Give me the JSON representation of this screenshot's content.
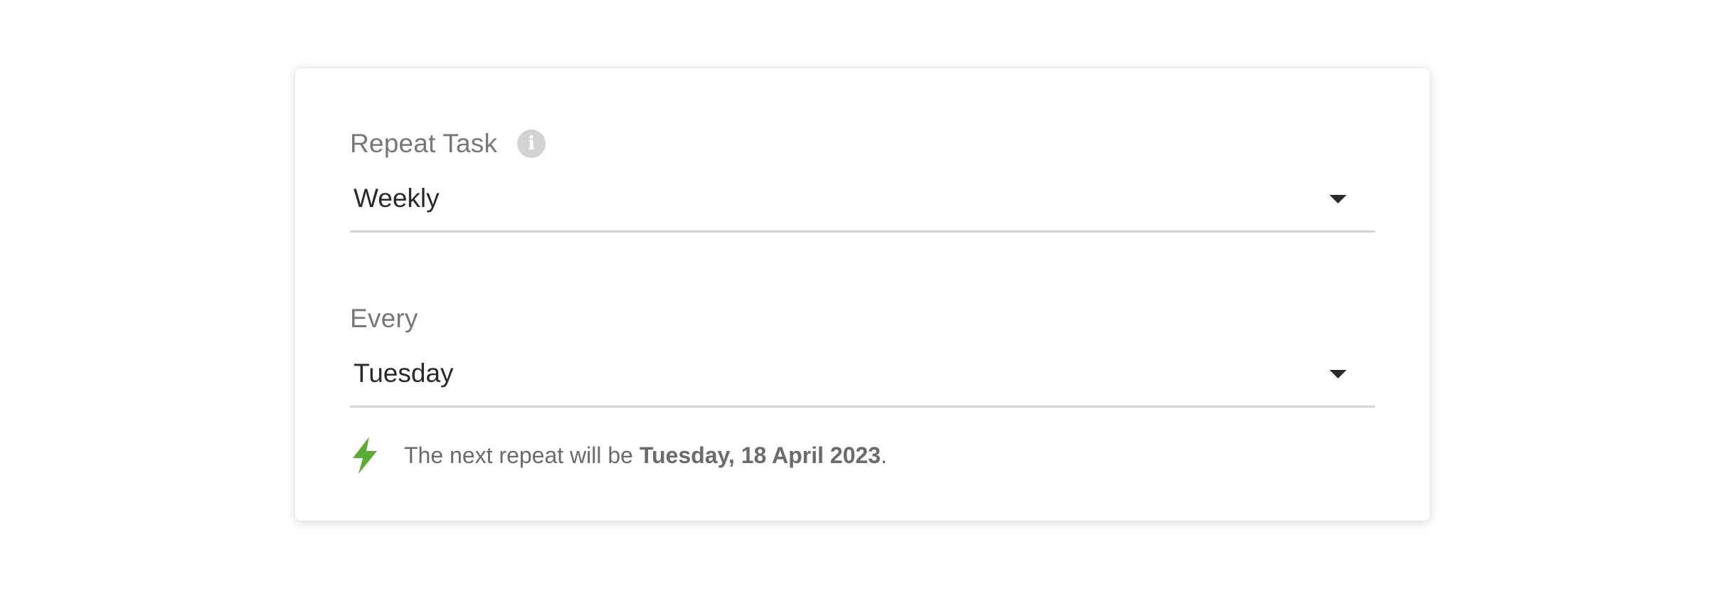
{
  "repeat_task": {
    "label": "Repeat Task",
    "info_icon": "info-icon",
    "selected_value": "Weekly"
  },
  "every": {
    "label": "Every",
    "selected_value": "Tuesday"
  },
  "hint": {
    "icon": "lightning-bolt-icon",
    "icon_color": "#5aac35",
    "prefix": "The next repeat will be",
    "date": "Tuesday, 18 April 2023",
    "suffix": "."
  }
}
